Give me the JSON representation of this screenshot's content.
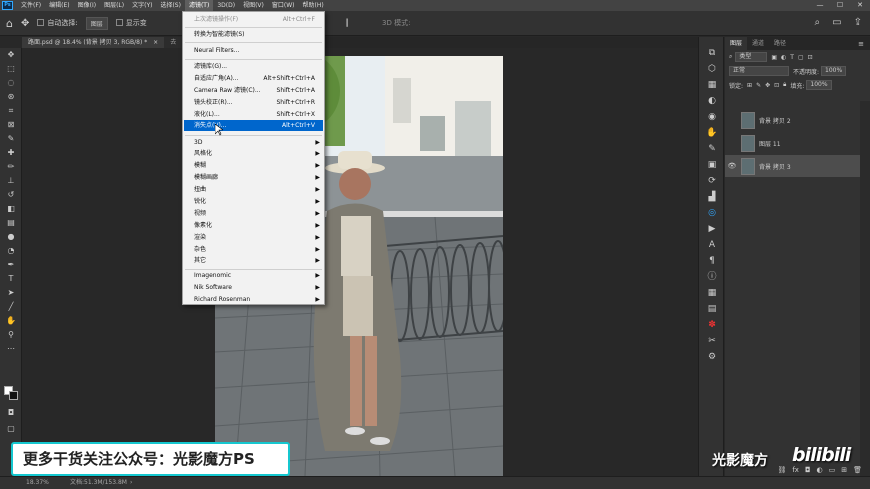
{
  "menubar": {
    "items": [
      "文件(F)",
      "编辑(E)",
      "图像(I)",
      "图层(L)",
      "文字(Y)",
      "选择(S)",
      "滤镜(T)",
      "3D(D)",
      "视图(V)",
      "窗口(W)",
      "帮助(H)"
    ],
    "active_index": 6,
    "logo": "Ps"
  },
  "options_bar": {
    "auto_select_label": "自动选择:",
    "auto_select_value": "图层",
    "show_transform_label": "显示变",
    "mode_3d_label": "3D 模式:"
  },
  "document_tabs": [
    {
      "title": "路面.psd @ 18.4% (背景 拷贝 3, RGB/8) *"
    },
    {
      "title": "去"
    }
  ],
  "filter_menu": {
    "items": [
      {
        "label": "上次滤镜操作(F)",
        "shortcut": "Alt+Ctrl+F",
        "disabled": true
      },
      {
        "sep": true
      },
      {
        "label": "转换为智能滤镜(S)"
      },
      {
        "sep": true
      },
      {
        "label": "Neural Filters..."
      },
      {
        "sep": true
      },
      {
        "label": "滤镜库(G)..."
      },
      {
        "label": "自适应广角(A)...",
        "shortcut": "Alt+Shift+Ctrl+A"
      },
      {
        "label": "Camera Raw 滤镜(C)...",
        "shortcut": "Shift+Ctrl+A"
      },
      {
        "label": "镜头校正(R)...",
        "shortcut": "Shift+Ctrl+R"
      },
      {
        "label": "液化(L)...",
        "shortcut": "Shift+Ctrl+X"
      },
      {
        "label": "消失点(V)...",
        "shortcut": "Alt+Ctrl+V",
        "highlighted": true
      },
      {
        "sep": true
      },
      {
        "label": "3D",
        "submenu": true
      },
      {
        "label": "风格化",
        "submenu": true
      },
      {
        "label": "模糊",
        "submenu": true
      },
      {
        "label": "模糊画廊",
        "submenu": true
      },
      {
        "label": "扭曲",
        "submenu": true
      },
      {
        "label": "锐化",
        "submenu": true
      },
      {
        "label": "视频",
        "submenu": true
      },
      {
        "label": "像素化",
        "submenu": true
      },
      {
        "label": "渲染",
        "submenu": true
      },
      {
        "label": "杂色",
        "submenu": true
      },
      {
        "label": "其它",
        "submenu": true
      },
      {
        "sep": true
      },
      {
        "label": "Imagenomic",
        "submenu": true
      },
      {
        "label": "Nik Software",
        "submenu": true
      },
      {
        "label": "Richard Rosenman",
        "submenu": true
      }
    ]
  },
  "layers_panel": {
    "tabs": [
      "图层",
      "通道",
      "路径"
    ],
    "filter_kind": "类型",
    "blend_mode": "正常",
    "opacity_label": "不透明度:",
    "opacity_value": "100%",
    "lock_label": "锁定:",
    "fill_label": "填充:",
    "fill_value": "100%",
    "layers": [
      {
        "name": "背景 拷贝 2",
        "visible": false,
        "selected": false
      },
      {
        "name": "图层 11",
        "visible": false,
        "selected": false
      },
      {
        "name": "背景 拷贝 3",
        "visible": true,
        "selected": true
      }
    ]
  },
  "status_bar": {
    "zoom": "18.37%",
    "doc_info": "文档:51.3M/153.8M"
  },
  "overlays": {
    "promo_text": "更多干货关注公众号：光影魔方PS",
    "brand_text": "光影魔方",
    "watermark": "bilibili"
  },
  "colors": {
    "accent": "#31a8ff",
    "menu_highlight": "#0066cc",
    "promo_border": "#15c7cf"
  }
}
